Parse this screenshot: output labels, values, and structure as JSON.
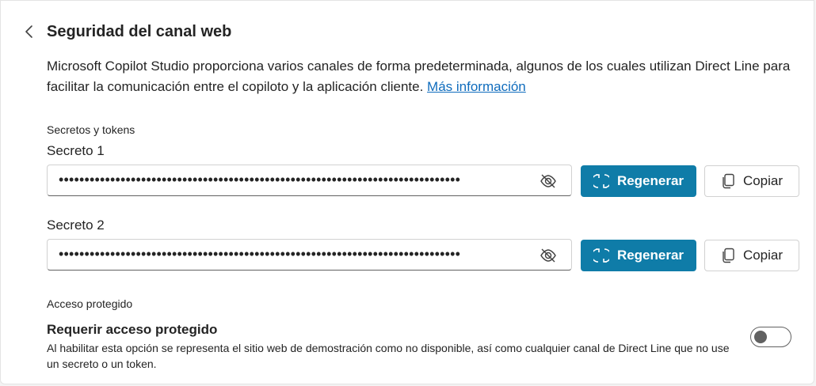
{
  "header": {
    "title": "Seguridad del canal web"
  },
  "description": {
    "text": "Microsoft Copilot Studio proporciona varios canales de forma predeterminada, algunos de los cuales utilizan Direct Line para facilitar la comunicación entre el copiloto y la aplicación cliente.",
    "link_label": "Más información"
  },
  "secrets": {
    "section_label": "Secretos y tokens",
    "items": [
      {
        "label": "Secreto 1",
        "masked_value": "••••••••••••••••••••••••••••••••••••••••••••••••••••••••••••••••••••••••••••••",
        "regenerate_label": "Regenerar",
        "copy_label": "Copiar"
      },
      {
        "label": "Secreto 2",
        "masked_value": "••••••••••••••••••••••••••••••••••••••••••••••••••••••••••••••••••••••••••••••",
        "regenerate_label": "Regenerar",
        "copy_label": "Copiar"
      }
    ]
  },
  "protected_access": {
    "section_label": "Acceso protegido",
    "title": "Requerir acceso protegido",
    "description": "Al habilitar esta opción se representa el sitio web de demostración como no disponible, así como cualquier canal de Direct Line que no use un secreto o un token.",
    "toggle_on": false
  },
  "colors": {
    "primary": "#0f7ca8",
    "link": "#0f6cbd",
    "text": "#242424"
  },
  "icons": {
    "back": "chevron-left-icon",
    "visibility": "eye-off-icon",
    "regenerate": "refresh-icon",
    "copy": "copy-icon"
  }
}
